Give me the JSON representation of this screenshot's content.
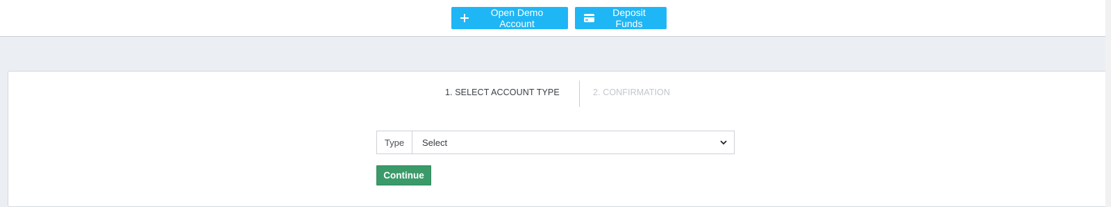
{
  "header": {
    "open_demo_label": "Open Demo Account",
    "open_demo_icon": "plus-icon",
    "deposit_label": "Deposit Funds",
    "deposit_icon": "credit-card-icon",
    "accent_color": "#1fb6f5"
  },
  "steps": {
    "items": [
      {
        "label": "1. SELECT ACCOUNT TYPE",
        "state": "active"
      },
      {
        "label": "2. CONFIRMATION",
        "state": "inactive"
      }
    ]
  },
  "form": {
    "type_label": "Type",
    "type_value": "Select",
    "select_icon": "chevron-down-icon",
    "continue_label": "Continue",
    "continue_color": "#3b9a6a"
  }
}
